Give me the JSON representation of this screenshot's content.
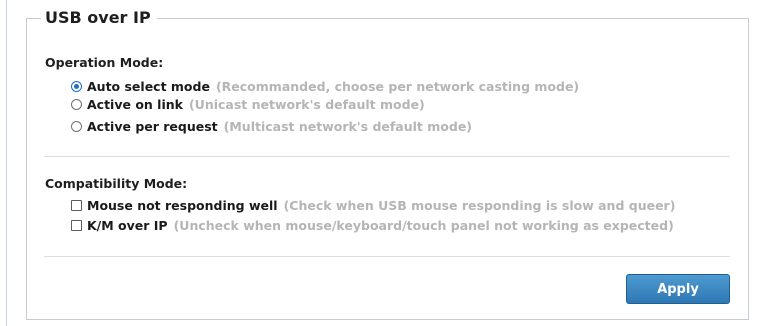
{
  "panel": {
    "title": "USB over IP"
  },
  "operation_mode": {
    "title": "Operation Mode:",
    "options": [
      {
        "label": "Auto select mode",
        "hint": "(Recommanded, choose per network casting mode)",
        "selected": true
      },
      {
        "label": "Active on link",
        "hint": "(Unicast network's default mode)",
        "selected": false
      },
      {
        "label": "Active per request",
        "hint": "(Multicast network's default mode)",
        "selected": false
      }
    ]
  },
  "compatibility_mode": {
    "title": "Compatibility Mode:",
    "options": [
      {
        "label": "Mouse not responding well",
        "hint": "(Check when USB mouse responding is slow and queer)",
        "checked": false
      },
      {
        "label": "K/M over IP",
        "hint": "(Uncheck when mouse/keyboard/touch panel not working as expected)",
        "checked": false
      }
    ]
  },
  "actions": {
    "apply_label": "Apply"
  },
  "colors": {
    "accent": "#2f78b5",
    "hint_text": "#b5b5b5",
    "border": "#c6ccd2"
  }
}
